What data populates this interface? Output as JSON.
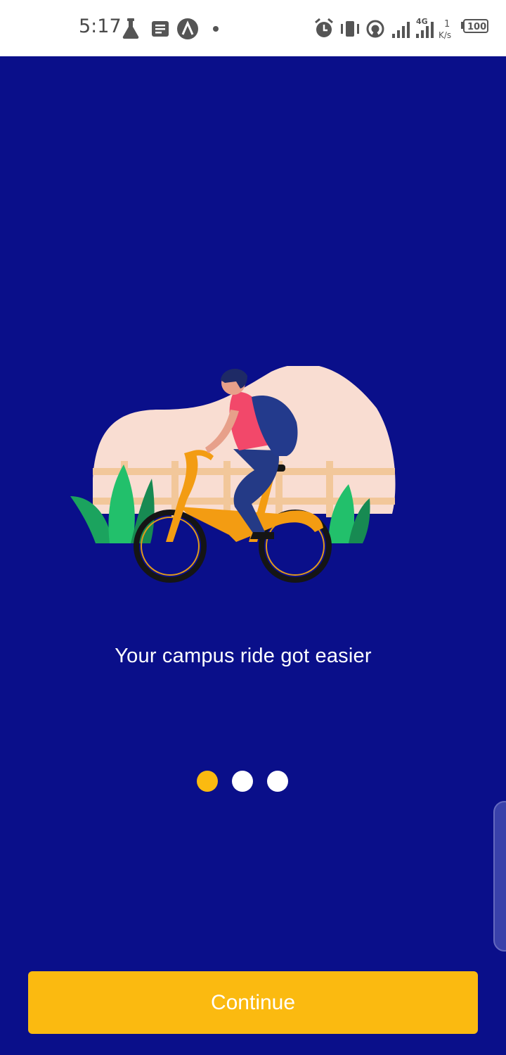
{
  "status_bar": {
    "time": "5:17",
    "left_icons": [
      "lab-flask-icon",
      "notes-icon",
      "app-a-icon",
      "dot-icon"
    ],
    "right_icons": [
      "alarm-icon",
      "vibrate-icon",
      "hotspot-icon",
      "signal-icon",
      "signal-4g-icon",
      "speed-icon",
      "battery-icon"
    ],
    "network_type": "4G",
    "speed_value": "1",
    "speed_unit": "K/s",
    "battery_level": "100"
  },
  "onboarding": {
    "illustration": "person-riding-bicycle-illustration",
    "tagline": "Your campus ride got easier",
    "page_count": 3,
    "active_page": 1
  },
  "actions": {
    "continue_label": "Continue"
  },
  "colors": {
    "background": "#0A0F8A",
    "accent": "#FBBA10",
    "text": "#FFFFFF"
  }
}
